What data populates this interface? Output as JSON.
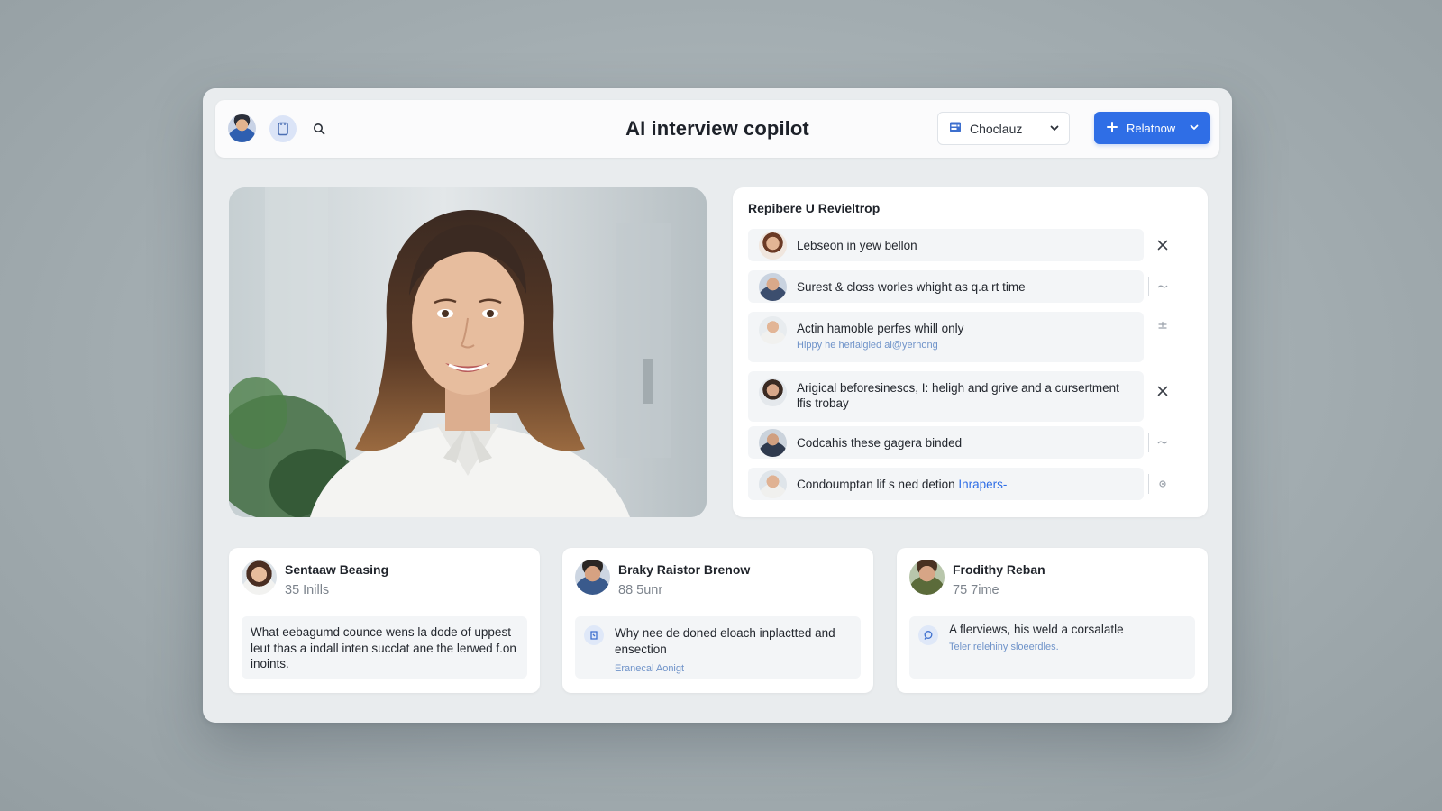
{
  "header": {
    "title": "AI interview copilot",
    "dropdown_label": "Choclauz",
    "primary_button_label": "Relatnow"
  },
  "icons": {
    "doc": "document-icon",
    "search": "search-icon",
    "calendar": "calendar-icon",
    "chevron": "chevron-down-icon",
    "plus": "plus-icon",
    "close": "close-icon"
  },
  "colors": {
    "accent": "#2f6ee6",
    "background": "#e9ecee",
    "link": "#2f6ee6",
    "subtext": "#6f93c9"
  },
  "panel": {
    "title": "Repibere U Revieltrop",
    "items": [
      {
        "text": "Lebseon in yew bellon",
        "action": "close"
      },
      {
        "text": "Surest & closs worles whight as q.a rt time",
        "action": "wave"
      },
      {
        "text": "Actin hamoble perfes whill only",
        "sub": "Hippy he herlalgled al@yerhong",
        "action": "plus-minus"
      },
      {
        "text": "Arigical beforesinescs, I: heligh and grive and a cursertment lfis trobay",
        "action": "close"
      },
      {
        "text": "Codcahis these gagera binded",
        "action": "wave"
      },
      {
        "text": "Condoumptan lif s ned detion",
        "link": "Inrapers-",
        "action": "dot"
      }
    ]
  },
  "cards": [
    {
      "name": "Sentaaw Beasing",
      "meta": "35 Inills",
      "text": "What eebagumd counce wens la dode of uppest leut thas a indall inten succlat ane the lerwed f.on inoints."
    },
    {
      "name": "Braky Raistor Brenow",
      "meta": "88 5unr",
      "text": "Why nee de doned eloach inplactted and ensection",
      "sub": "Eranecal Aonigt"
    },
    {
      "name": "Frodithy Reban",
      "meta": "75 7ime",
      "text": "A flerviews, his weld a corsalatle",
      "sub": "Teler relehiny sloeerdles."
    }
  ]
}
